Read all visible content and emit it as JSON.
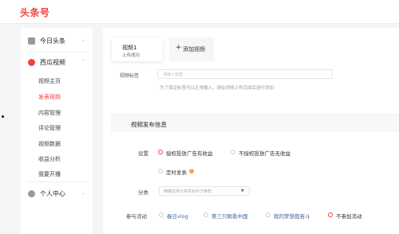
{
  "header": {
    "logo": "头条号"
  },
  "sidebar": {
    "sections": [
      {
        "label": "今日头条",
        "icon": "home-icon"
      },
      {
        "label": "西瓜视频",
        "icon": "watermelon-icon"
      },
      {
        "label": "个人中心",
        "icon": "user-icon"
      }
    ],
    "sub_items": [
      "视频主页",
      "发表视频",
      "内容管理",
      "评论管理",
      "视频数据",
      "收益分析",
      "我要开播"
    ],
    "active_sub": "发表视频"
  },
  "tabs": {
    "video_name": "视频1",
    "video_status": "上传成功",
    "add_label": "添加视频"
  },
  "tag_field": {
    "label": "视频标签",
    "placeholder": "请输入标签",
    "hint": "为了保证标签可以正常输入，请在视频上传完成后进行添加"
  },
  "publish": {
    "title": "视频发布信息",
    "setting_label": "设置",
    "option_ad": "授权投放广告有收益",
    "option_no_ad": "不授权投放广告无收益",
    "option_scheduled": "定时发表",
    "category_label": "分类",
    "category_placeholder": "精确选择分类更有利于推荐",
    "activity_label": "参与活动",
    "activities": [
      "春日vlog",
      "第三只眼看中国",
      "我的梦想我奋斗",
      "不参加活动"
    ],
    "selected_activity": "不参加活动"
  },
  "colors": {
    "brand": "#f04142",
    "activity_link": "#406599"
  }
}
